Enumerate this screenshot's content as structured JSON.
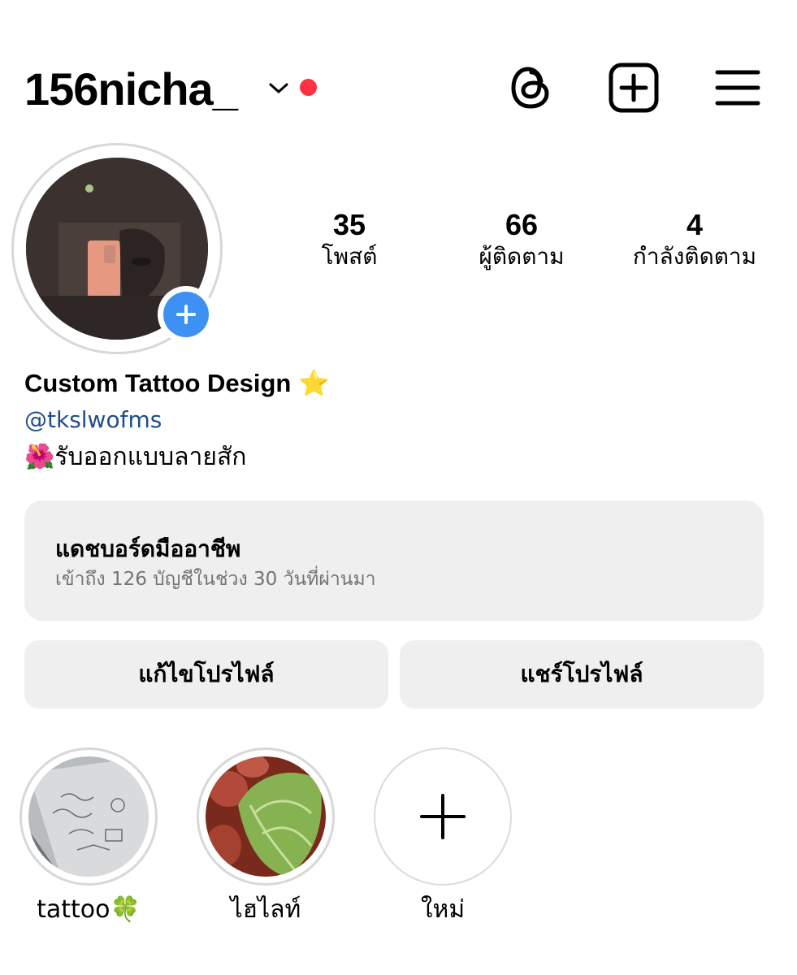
{
  "header": {
    "username": "156nicha_",
    "icons": [
      "chevron-down-icon",
      "threads-icon",
      "create-post-icon",
      "hamburger-menu-icon"
    ],
    "notification_color": "#ff3040"
  },
  "profile": {
    "stats": {
      "posts": {
        "value": "35",
        "label": "โพสต์"
      },
      "followers": {
        "value": "66",
        "label": "ผู้ติดตาม"
      },
      "following": {
        "value": "4",
        "label": "กำลังติดตาม"
      }
    },
    "bio": {
      "name": "Custom Tattoo Design ⭐️",
      "threads_handle": "@tkslwofms",
      "text": "🌺รับออกแบบลายสัก"
    },
    "add_story_color": "#3d91f2"
  },
  "dashboard": {
    "title": "แดชบอร์ดมืออาชีพ",
    "subtitle": "เข้าถึง 126 บัญชีในช่วง 30 วันที่ผ่านมา"
  },
  "buttons": {
    "edit_profile": "แก้ไขโปรไฟล์",
    "share_profile": "แชร์โปรไฟล์"
  },
  "highlights": [
    {
      "label": "tattoo🍀"
    },
    {
      "label": "ไฮไลท์"
    },
    {
      "label": "ใหม่"
    }
  ]
}
